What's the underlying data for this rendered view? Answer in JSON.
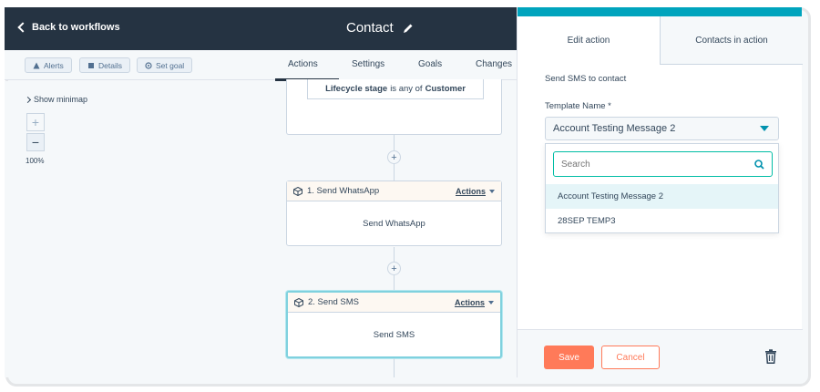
{
  "header": {
    "back_label": "Back to workflows",
    "title": "Contact"
  },
  "subbar": {
    "alerts": "Alerts",
    "details": "Details",
    "set_goal": "Set goal",
    "tabs": [
      "Actions",
      "Settings",
      "Goals",
      "Changes"
    ],
    "active_tab": "Actions"
  },
  "canvas": {
    "minimap_label": "Show minimap",
    "zoom_in": "+",
    "zoom_out": "−",
    "zoom_level": "100%",
    "trigger": {
      "prefix": "Lifecycle stage",
      "middle": "is any of",
      "value": "Customer"
    },
    "cards": [
      {
        "title": "1. Send WhatsApp",
        "actions_label": "Actions",
        "body": "Send WhatsApp"
      },
      {
        "title": "2. Send SMS",
        "actions_label": "Actions",
        "body": "Send SMS"
      }
    ]
  },
  "panel": {
    "accent_color": "#00a4bd",
    "tabs": [
      "Edit action",
      "Contacts in action"
    ],
    "action_type": "Send SMS to contact",
    "template_label": "Template Name *",
    "selected_template": "Account Testing Message 2",
    "search_placeholder": "Search",
    "options": [
      "Account Testing Message 2",
      "28SEP TEMP3"
    ],
    "save_label": "Save",
    "cancel_label": "Cancel"
  },
  "colors": {
    "header_bg": "#253342",
    "save_button": "#ff7a59",
    "search_focus": "#00bda5"
  }
}
